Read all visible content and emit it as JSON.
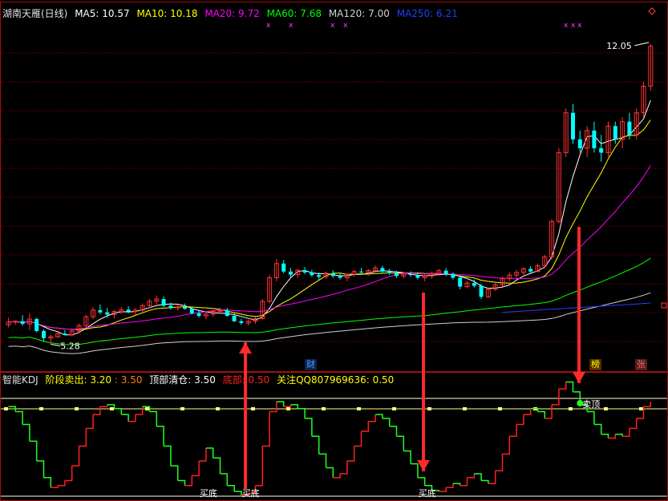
{
  "main_panel": {
    "title": "湖南天雁(日线)",
    "ma_labels": [
      {
        "label": "MA5: 10.57",
        "color": "#ffffff"
      },
      {
        "label": "MA10: 10.18",
        "color": "#ffff00"
      },
      {
        "label": "MA20: 9.72",
        "color": "#ff00ff"
      },
      {
        "label": "MA60: 7.68",
        "color": "#00ff00"
      },
      {
        "label": "MA120: 7.00",
        "color": "#d0d0d0"
      },
      {
        "label": "MA250: 6.21",
        "color": "#2040ff"
      }
    ],
    "high_label": "12.05",
    "low_label": "5.28",
    "bottom_tags": [
      {
        "label": "财",
        "color": "#40a0ff"
      },
      {
        "label": "榜",
        "color": "#ffff00"
      },
      {
        "label": "张",
        "color": "#ff6060"
      }
    ]
  },
  "indicator_panel": {
    "title": "智能KDJ",
    "params": [
      {
        "label": "阶段卖出: 3.20",
        "color": "#ffff00"
      },
      {
        "label": ": 3.50",
        "color": "#ff8000"
      },
      {
        "label": "顶部清仓: 3.50",
        "color": "#ffffff"
      },
      {
        "label": "底部: 0.50",
        "color": "#ff2020"
      },
      {
        "label": "关注QQ807969636: 0.50",
        "color": "#ffff00"
      }
    ],
    "signals": {
      "buy": "买底",
      "sell": "卖顶"
    }
  },
  "colors": {
    "up": "#ff3232",
    "down": "#00ffff",
    "grid": "#8b0000",
    "frame": "#a01010",
    "arrow": "#ff2a2a"
  },
  "chart_data": {
    "type": "candlestick",
    "title": "湖南天雁(日线)",
    "y_markers": {
      "high": 12.05,
      "low": 5.28
    },
    "candles": [
      [
        5.72,
        5.88,
        5.66,
        5.78
      ],
      [
        5.78,
        5.82,
        5.72,
        5.8
      ],
      [
        5.8,
        5.94,
        5.7,
        5.74
      ],
      [
        5.74,
        5.98,
        5.6,
        5.85
      ],
      [
        5.85,
        5.88,
        5.55,
        5.58
      ],
      [
        5.58,
        5.62,
        5.35,
        5.42
      ],
      [
        5.42,
        5.5,
        5.28,
        5.45
      ],
      [
        5.45,
        5.56,
        5.42,
        5.52
      ],
      [
        5.52,
        5.6,
        5.48,
        5.49
      ],
      [
        5.49,
        5.62,
        5.46,
        5.58
      ],
      [
        5.58,
        5.75,
        5.52,
        5.7
      ],
      [
        5.7,
        5.95,
        5.66,
        5.9
      ],
      [
        5.9,
        6.12,
        5.84,
        6.05
      ],
      [
        6.05,
        6.18,
        5.96,
        6.0
      ],
      [
        6.0,
        6.1,
        5.88,
        5.95
      ],
      [
        5.95,
        6.06,
        5.86,
        6.02
      ],
      [
        6.02,
        6.12,
        5.96,
        6.06
      ],
      [
        6.06,
        6.14,
        5.98,
        6.02
      ],
      [
        6.02,
        6.1,
        5.94,
        6.05
      ],
      [
        6.05,
        6.2,
        6.0,
        6.15
      ],
      [
        6.15,
        6.3,
        6.1,
        6.25
      ],
      [
        6.25,
        6.38,
        6.18,
        6.3
      ],
      [
        6.3,
        6.36,
        6.12,
        6.15
      ],
      [
        6.15,
        6.22,
        6.06,
        6.1
      ],
      [
        6.1,
        6.18,
        6.04,
        6.12
      ],
      [
        6.12,
        6.2,
        6.06,
        6.08
      ],
      [
        6.08,
        6.14,
        5.95,
        5.98
      ],
      [
        5.98,
        6.06,
        5.88,
        5.92
      ],
      [
        5.92,
        6.0,
        5.84,
        5.96
      ],
      [
        5.96,
        6.06,
        5.9,
        6.02
      ],
      [
        6.02,
        6.1,
        5.96,
        6.04
      ],
      [
        6.04,
        6.1,
        5.9,
        5.92
      ],
      [
        5.92,
        5.98,
        5.78,
        5.8
      ],
      [
        5.8,
        5.86,
        5.72,
        5.76
      ],
      [
        5.76,
        5.84,
        5.7,
        5.8
      ],
      [
        5.8,
        5.9,
        5.74,
        5.86
      ],
      [
        5.86,
        6.3,
        5.84,
        6.25
      ],
      [
        6.25,
        6.85,
        6.2,
        6.78
      ],
      [
        6.78,
        7.2,
        6.7,
        7.1
      ],
      [
        7.1,
        7.18,
        6.88,
        6.92
      ],
      [
        6.92,
        7.0,
        6.8,
        6.85
      ],
      [
        6.85,
        6.98,
        6.78,
        6.95
      ],
      [
        6.95,
        7.02,
        6.86,
        6.9
      ],
      [
        6.9,
        6.96,
        6.8,
        6.84
      ],
      [
        6.84,
        6.9,
        6.74,
        6.8
      ],
      [
        6.8,
        6.92,
        6.76,
        6.88
      ],
      [
        6.88,
        6.95,
        6.78,
        6.82
      ],
      [
        6.82,
        6.9,
        6.74,
        6.78
      ],
      [
        6.78,
        6.88,
        6.7,
        6.86
      ],
      [
        6.86,
        6.96,
        6.8,
        6.92
      ],
      [
        6.92,
        7.0,
        6.86,
        6.9
      ],
      [
        6.9,
        6.98,
        6.82,
        6.94
      ],
      [
        6.94,
        7.06,
        6.9,
        7.0
      ],
      [
        7.0,
        7.05,
        6.88,
        6.92
      ],
      [
        6.92,
        6.98,
        6.84,
        6.88
      ],
      [
        6.88,
        6.94,
        6.78,
        6.82
      ],
      [
        6.82,
        6.9,
        6.76,
        6.86
      ],
      [
        6.86,
        6.92,
        6.8,
        6.84
      ],
      [
        6.84,
        6.88,
        6.74,
        6.78
      ],
      [
        6.78,
        6.86,
        6.7,
        6.82
      ],
      [
        6.82,
        6.92,
        6.76,
        6.88
      ],
      [
        6.88,
        6.98,
        6.82,
        6.94
      ],
      [
        6.94,
        7.0,
        6.82,
        6.86
      ],
      [
        6.86,
        6.9,
        6.74,
        6.78
      ],
      [
        6.78,
        6.84,
        6.52,
        6.58
      ],
      [
        6.58,
        6.7,
        6.54,
        6.66
      ],
      [
        6.66,
        6.74,
        6.56,
        6.6
      ],
      [
        6.6,
        6.64,
        6.3,
        6.35
      ],
      [
        6.35,
        6.56,
        6.32,
        6.52
      ],
      [
        6.52,
        6.66,
        6.48,
        6.62
      ],
      [
        6.62,
        6.8,
        6.58,
        6.76
      ],
      [
        6.76,
        6.9,
        6.7,
        6.84
      ],
      [
        6.84,
        6.96,
        6.76,
        6.9
      ],
      [
        6.9,
        7.02,
        6.84,
        6.98
      ],
      [
        6.98,
        7.04,
        6.88,
        6.92
      ],
      [
        6.92,
        7.1,
        6.9,
        7.05
      ],
      [
        7.05,
        7.3,
        7.0,
        7.25
      ],
      [
        7.25,
        8.1,
        7.2,
        8.05
      ],
      [
        8.05,
        9.7,
        8.0,
        9.6
      ],
      [
        9.6,
        10.6,
        9.5,
        10.5
      ],
      [
        10.5,
        10.7,
        9.8,
        9.9
      ],
      [
        9.9,
        10.1,
        9.6,
        9.7
      ],
      [
        9.7,
        10.2,
        9.5,
        10.1
      ],
      [
        10.1,
        10.3,
        9.6,
        9.7
      ],
      [
        9.7,
        10.0,
        9.4,
        9.6
      ],
      [
        9.6,
        10.3,
        9.5,
        10.2
      ],
      [
        10.2,
        10.3,
        9.8,
        9.9
      ],
      [
        9.9,
        10.4,
        9.7,
        10.3
      ],
      [
        10.3,
        10.5,
        9.9,
        10.0
      ],
      [
        10.0,
        10.6,
        9.9,
        10.5
      ],
      [
        10.5,
        11.2,
        10.4,
        11.1
      ],
      [
        11.1,
        12.05,
        11.0,
        12.0
      ]
    ],
    "kdj": [
      0.9,
      0.85,
      0.72,
      0.55,
      0.35,
      0.18,
      0.08,
      0.1,
      0.15,
      0.3,
      0.5,
      0.68,
      0.82,
      0.9,
      0.92,
      0.88,
      0.82,
      0.75,
      0.82,
      0.9,
      0.85,
      0.7,
      0.5,
      0.3,
      0.15,
      0.1,
      0.2,
      0.35,
      0.48,
      0.38,
      0.22,
      0.1,
      0.04,
      0.0,
      0.02,
      0.1,
      0.5,
      0.85,
      0.95,
      0.9,
      0.92,
      0.88,
      0.78,
      0.6,
      0.42,
      0.28,
      0.18,
      0.22,
      0.35,
      0.5,
      0.65,
      0.75,
      0.82,
      0.78,
      0.7,
      0.6,
      0.45,
      0.32,
      0.18,
      0.1,
      0.05,
      0.04,
      0.08,
      0.12,
      0.1,
      0.18,
      0.22,
      0.15,
      0.12,
      0.25,
      0.42,
      0.6,
      0.72,
      0.82,
      0.88,
      0.85,
      0.78,
      0.92,
      1.08,
      1.15,
      1.05,
      0.92,
      0.85,
      0.72,
      0.62,
      0.58,
      0.62,
      0.6,
      0.68,
      0.78,
      0.9,
      0.95
    ]
  }
}
